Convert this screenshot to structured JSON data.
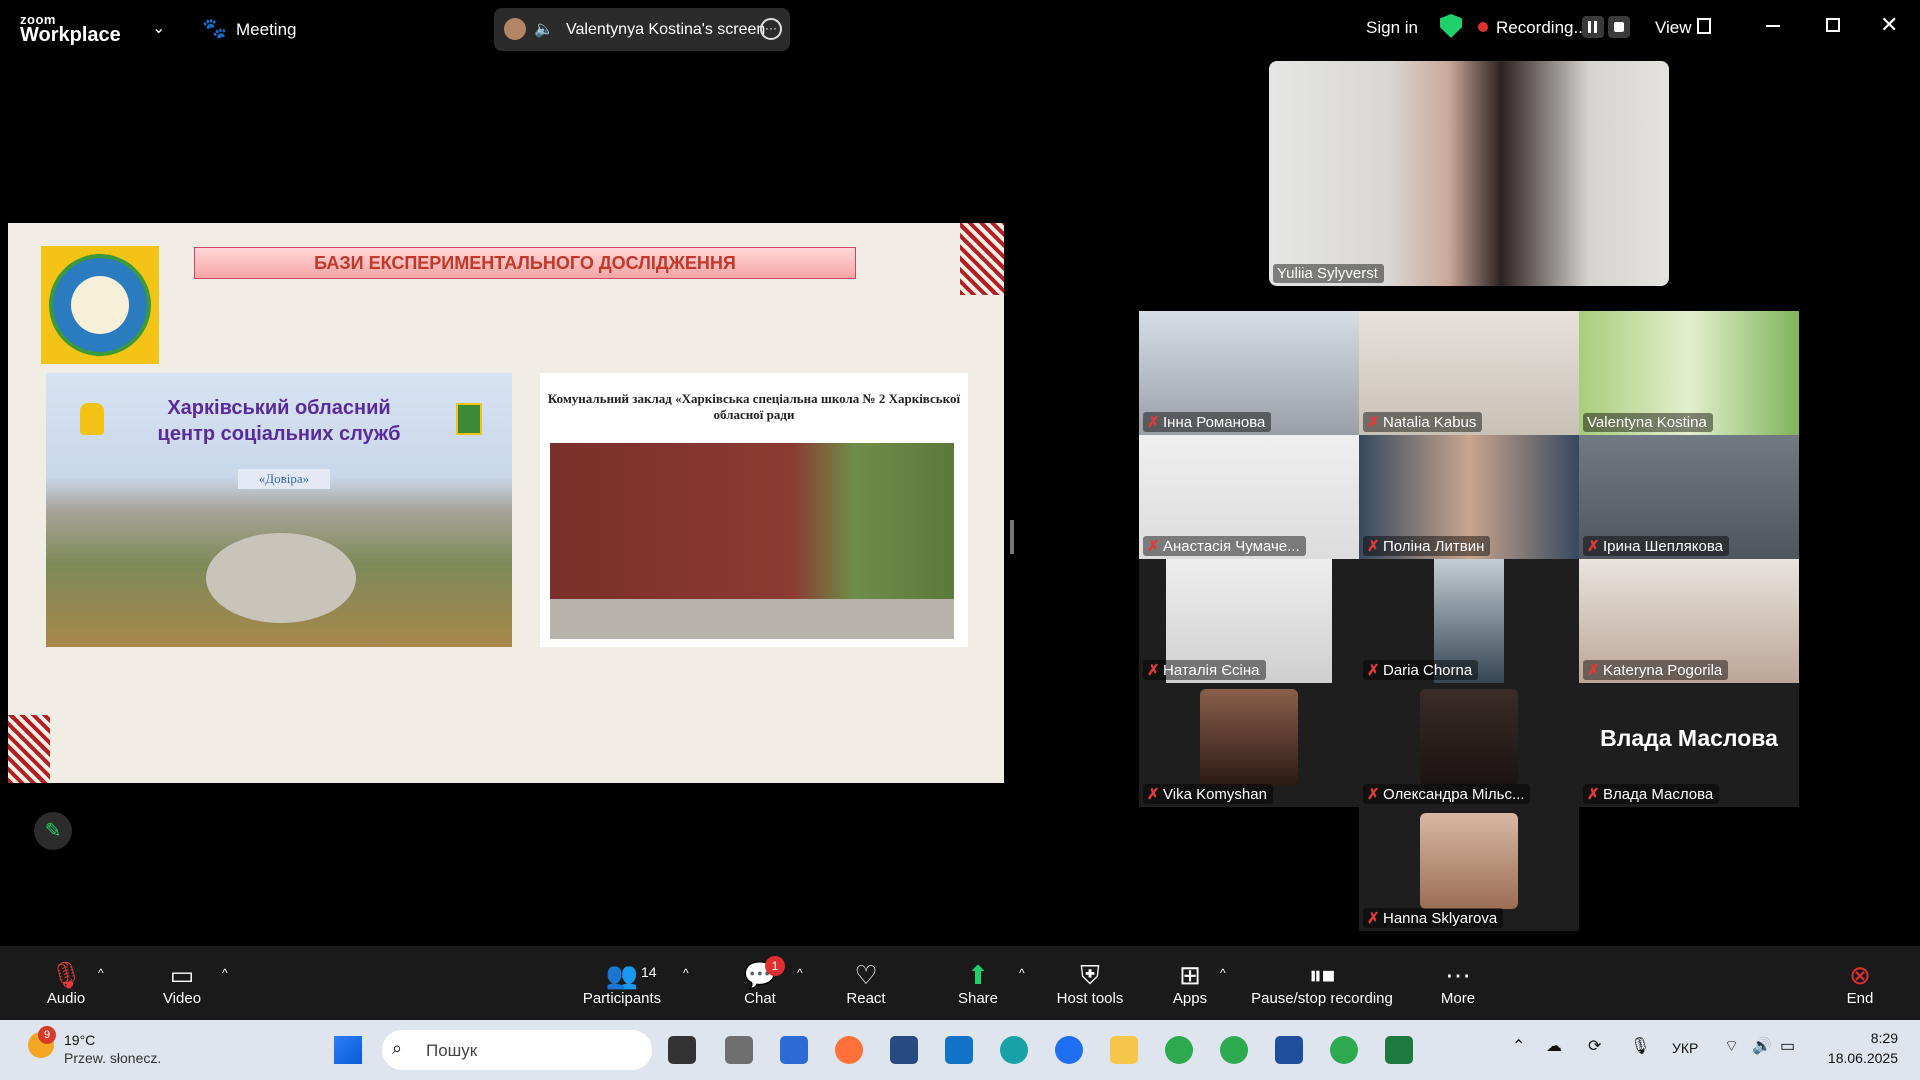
{
  "app": {
    "logo_top": "zoom",
    "logo_bottom": "Workplace",
    "meeting_label": "Meeting",
    "screen_label": "Valentynya Kostina's screen",
    "sign_in": "Sign in",
    "recording_label": "Recording...",
    "view_label": "View"
  },
  "slide": {
    "title": "БАЗИ ЕКСПЕРИМЕНТАЛЬНОГО ДОСЛІДЖЕННЯ",
    "card1_title_line1": "Харківський обласний",
    "card1_title_line2": "центр соціальних служб",
    "card1_badge": "«Довіра»",
    "card2_title": "Комунальний заклад «Харківська спеціальна школа № 2 Харківської обласної ради"
  },
  "participants": {
    "speaker": "Yuliia Sylyverst",
    "grid": [
      "Інна Романова",
      "Natalia Kabus",
      "Valentyna Kostina",
      "Анастасія Чумаче...",
      "Поліна Литвин",
      "Ірина Шеплякова",
      "Наталія Єсіна",
      "Daria Chorna",
      "Kateryna Pogorila",
      "Vika Komyshan",
      "Олександра Мільс...",
      "Влада Маслова",
      "Hanna Sklyarova"
    ],
    "big_name": "Влада Маслова"
  },
  "toolbar": {
    "audio": "Audio",
    "video": "Video",
    "participants": "Participants",
    "participants_count": "14",
    "chat": "Chat",
    "chat_badge": "1",
    "react": "React",
    "share": "Share",
    "host_tools": "Host tools",
    "apps": "Apps",
    "pause_stop": "Pause/stop recording",
    "more": "More",
    "end": "End"
  },
  "taskbar": {
    "weather_badge": "9",
    "temperature": "19°C",
    "weather_desc": "Przew. słonecz.",
    "search_placeholder": "Пошук",
    "lang": "УКР",
    "time": "8:29",
    "date": "18.06.2025"
  },
  "colors": {
    "accent_green": "#1fd16a",
    "record_red": "#e02f2f",
    "slide_bg": "#f1ede4"
  }
}
